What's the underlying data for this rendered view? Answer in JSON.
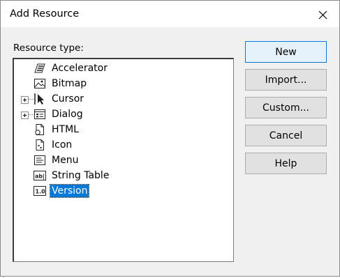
{
  "dialog": {
    "title": "Add Resource",
    "resource_type_label": "Resource type:"
  },
  "resource_types": [
    {
      "label": "Accelerator",
      "icon": "accelerator-icon",
      "expandable": false,
      "selected": false
    },
    {
      "label": "Bitmap",
      "icon": "bitmap-icon",
      "expandable": false,
      "selected": false
    },
    {
      "label": "Cursor",
      "icon": "cursor-icon",
      "expandable": true,
      "selected": false
    },
    {
      "label": "Dialog",
      "icon": "dialog-icon",
      "expandable": true,
      "selected": false
    },
    {
      "label": "HTML",
      "icon": "html-icon",
      "expandable": false,
      "selected": false
    },
    {
      "label": "Icon",
      "icon": "icon-resource-icon",
      "expandable": false,
      "selected": false
    },
    {
      "label": "Menu",
      "icon": "menu-icon",
      "expandable": false,
      "selected": false
    },
    {
      "label": "String Table",
      "icon": "string-table-icon",
      "expandable": false,
      "selected": false
    },
    {
      "label": "Version",
      "icon": "version-icon",
      "expandable": false,
      "selected": true
    }
  ],
  "buttons": {
    "new": "New",
    "import": "Import...",
    "custom": "Custom...",
    "cancel": "Cancel",
    "help": "Help"
  },
  "colors": {
    "selection": "#0078d7",
    "default_button_border": "#0078d7"
  }
}
